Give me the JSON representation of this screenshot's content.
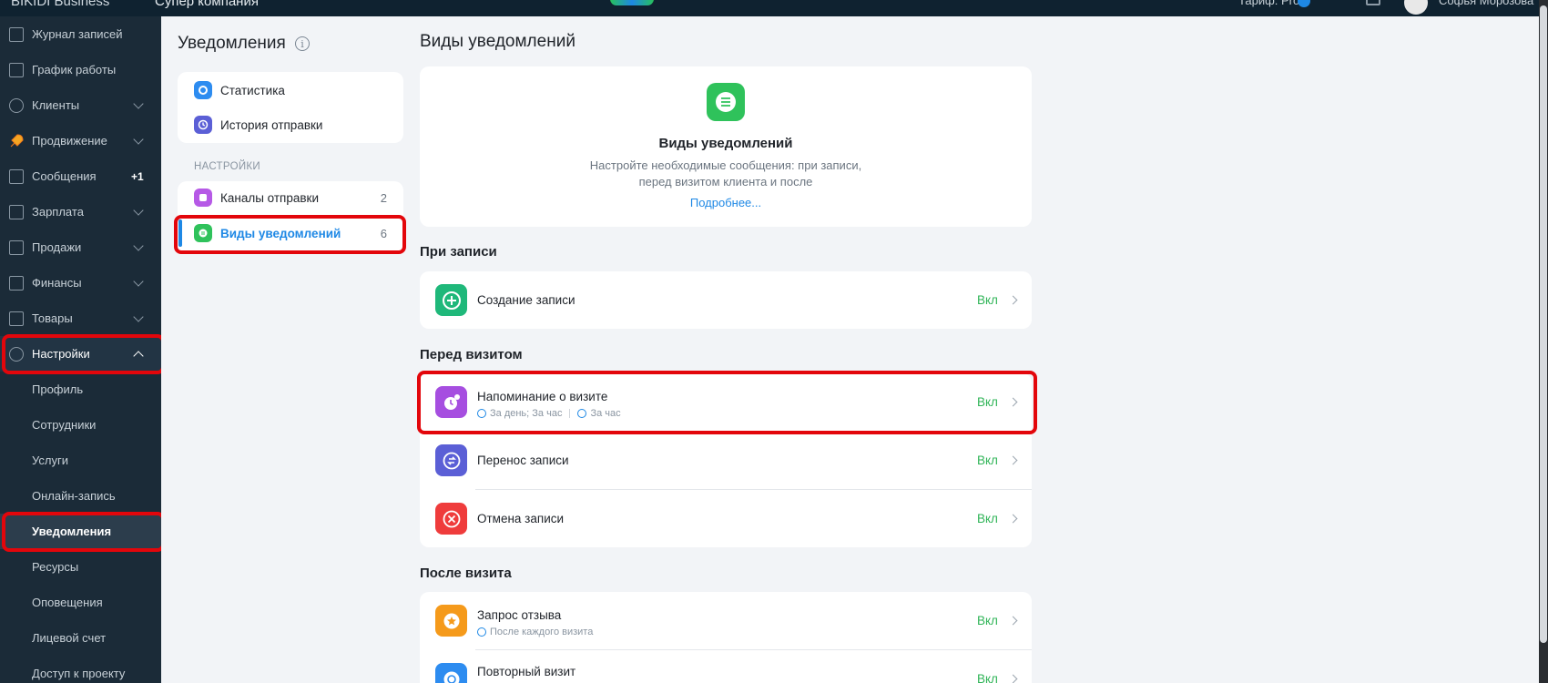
{
  "topbar": {
    "brand": "BIKIDI",
    "brand_suffix": " Business",
    "company": "Супер компания",
    "tariff": "Тариф: Pro",
    "user": "Софья Морозова"
  },
  "sidebar": {
    "items": [
      {
        "label": "Журнал записей",
        "icon": "journal-icon"
      },
      {
        "label": "График работы",
        "icon": "calendar-icon"
      },
      {
        "label": "Клиенты",
        "icon": "clients-icon"
      },
      {
        "label": "Продвижение",
        "icon": "rocket-icon"
      },
      {
        "label": "Сообщения",
        "icon": "messages-icon",
        "badge": "+1"
      },
      {
        "label": "Зарплата",
        "icon": "salary-icon"
      },
      {
        "label": "Продажи",
        "icon": "sales-icon"
      },
      {
        "label": "Финансы",
        "icon": "finance-icon"
      },
      {
        "label": "Товары",
        "icon": "goods-icon"
      },
      {
        "label": "Настройки",
        "icon": "gear-icon"
      }
    ],
    "subitems": [
      "Профиль",
      "Сотрудники",
      "Услуги",
      "Онлайн-запись",
      "Уведомления",
      "Ресурсы",
      "Оповещения",
      "Лицевой счет",
      "Доступ к проекту"
    ]
  },
  "left_panel": {
    "title": "Уведомления",
    "top_items": [
      {
        "label": "Статистика",
        "icon": "statistics-icon",
        "color": "#2d8cf0"
      },
      {
        "label": "История отправки",
        "icon": "history-icon",
        "color": "#5b5fd6"
      }
    ],
    "settings_caption": "НАСТРОЙКИ",
    "settings_items": [
      {
        "label": "Каналы отправки",
        "count": "2",
        "icon": "channels-icon",
        "color": "#b659e6"
      },
      {
        "label": "Виды уведомлений",
        "count": "6",
        "icon": "notification-types-icon",
        "color": "#2fc25b"
      }
    ]
  },
  "main": {
    "title": "Виды уведомлений",
    "hero": {
      "title": "Виды уведомлений",
      "desc_line1": "Настройте необходимые сообщения: при записи,",
      "desc_line2": "перед визитом клиента и после",
      "link": "Подробнее..."
    },
    "sections": [
      {
        "title": "При записи",
        "rows": [
          {
            "title": "Создание записи",
            "state": "Вкл",
            "icon": "plus-icon",
            "color": "#1fb87a"
          }
        ]
      },
      {
        "title": "Перед визитом",
        "rows": [
          {
            "title": "Напоминание о визите",
            "sub1": "За день; За час",
            "sub2": "За час",
            "state": "Вкл",
            "icon": "reminder-icon",
            "color": "#a64ee0"
          },
          {
            "title": "Перенос записи",
            "state": "Вкл",
            "icon": "reschedule-icon",
            "color": "#5b5fd6"
          },
          {
            "title": "Отмена записи",
            "state": "Вкл",
            "icon": "cancel-icon",
            "color": "#ef3c3c"
          }
        ]
      },
      {
        "title": "После визита",
        "rows": [
          {
            "title": "Запрос отзыва",
            "sub1": "После каждого визита",
            "state": "Вкл",
            "icon": "star-icon",
            "color": "#f59a1b"
          },
          {
            "title": "Повторный визит",
            "state": "Вкл",
            "icon": "repeat-icon",
            "color": "#2d8cf0"
          }
        ]
      }
    ]
  }
}
